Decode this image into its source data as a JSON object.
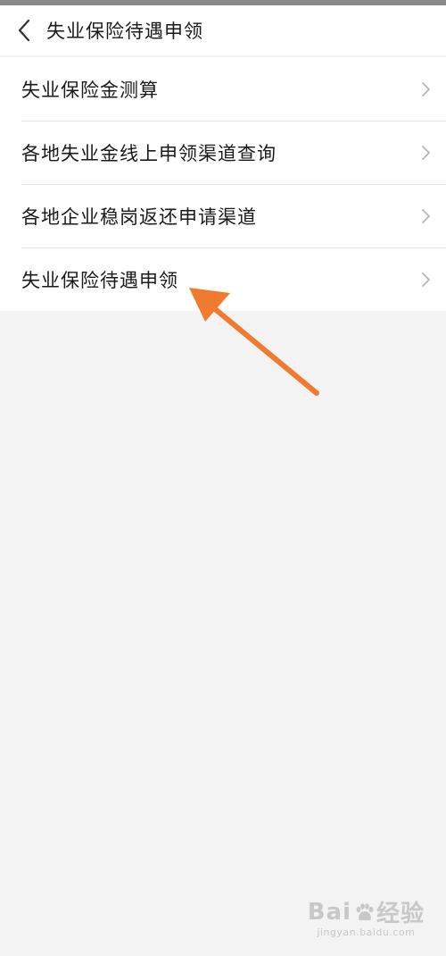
{
  "header": {
    "title": "失业保险待遇申领",
    "back_icon": "chevron-left-icon"
  },
  "menu": {
    "items": [
      {
        "label": "失业保险金测算"
      },
      {
        "label": "各地失业金线上申领渠道查询"
      },
      {
        "label": "各地企业稳岗返还申请渠道"
      },
      {
        "label": "失业保险待遇申领"
      }
    ],
    "chevron_icon": "chevron-right-icon"
  },
  "annotation": {
    "color": "#f07a30"
  },
  "watermark": {
    "brand_left": "Bai",
    "brand_right": "经验",
    "sub": "jingyan.baidu.com"
  },
  "colors": {
    "background": "#f3f3f3",
    "surface": "#ffffff",
    "divider": "#e6e6e6",
    "accent_arrow": "#f07a30"
  }
}
